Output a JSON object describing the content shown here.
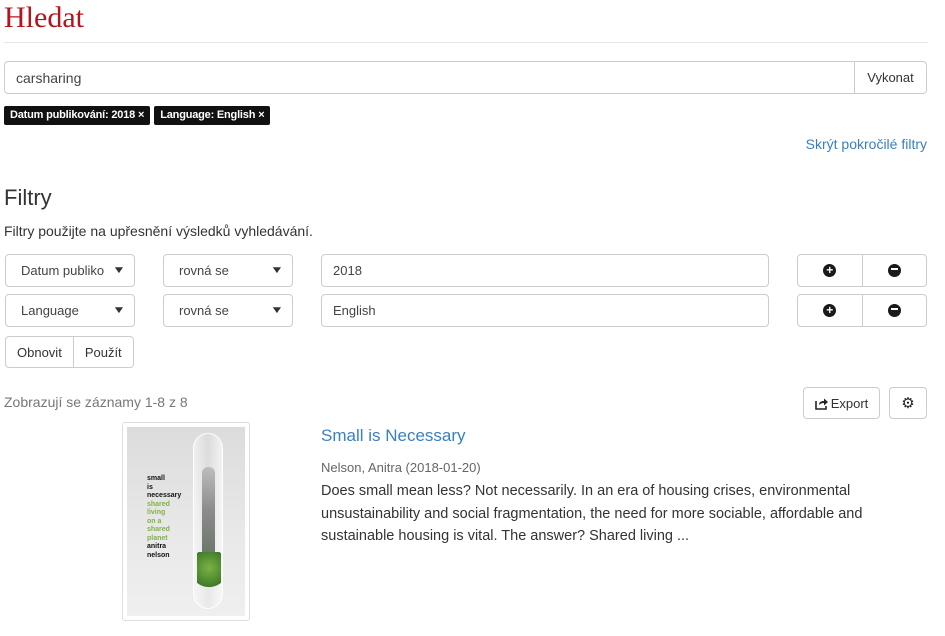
{
  "page": {
    "title": "Hledat"
  },
  "search": {
    "query": "carsharing",
    "submit_label": "Vykonat"
  },
  "active_filters": [
    {
      "label": "Datum publikování: 2018"
    },
    {
      "label": "Language: English"
    }
  ],
  "chip_remove_symbol": "×",
  "toggle_filters_label": "Skrýt pokročilé filtry",
  "filters": {
    "heading": "Filtry",
    "description": "Filtry použijte na upřesnění výsledků vyhledávání.",
    "rows": [
      {
        "field": "Datum publiko",
        "operator": "rovná se",
        "value": "2018"
      },
      {
        "field": "Language",
        "operator": "rovná se",
        "value": "English"
      }
    ],
    "reset_label": "Obnovit",
    "apply_label": "Použít"
  },
  "icons": {
    "add": "plus-circle-icon",
    "remove": "minus-circle-icon",
    "caret": "chevron-down-icon",
    "export": "share-icon",
    "settings": "gear-icon"
  },
  "results": {
    "count_text": "Zobrazují se záznamy 1-8 z 8",
    "export_label": "Export",
    "items": [
      {
        "title": "Small is Necessary",
        "meta": "Nelson, Anitra (2018-01-20)",
        "abstract": "Does small mean less? Not necessarily. In an era of housing crises, environmental unsustainability and social fragmentation, the need for more sociable, affordable and sustainable housing is vital. The answer? Shared living ...",
        "cover_text_black_top": [
          "small",
          "is",
          "necessary"
        ],
        "cover_text_green": [
          "shared",
          "living",
          "on a",
          "shared",
          "planet"
        ],
        "cover_text_black_bottom": [
          "anitra",
          "nelson"
        ]
      }
    ]
  },
  "colors": {
    "brand_red": "#b3141e",
    "link_blue": "#3a7fbf",
    "chip_bg": "#111111",
    "cover_green": "#7fb441"
  }
}
